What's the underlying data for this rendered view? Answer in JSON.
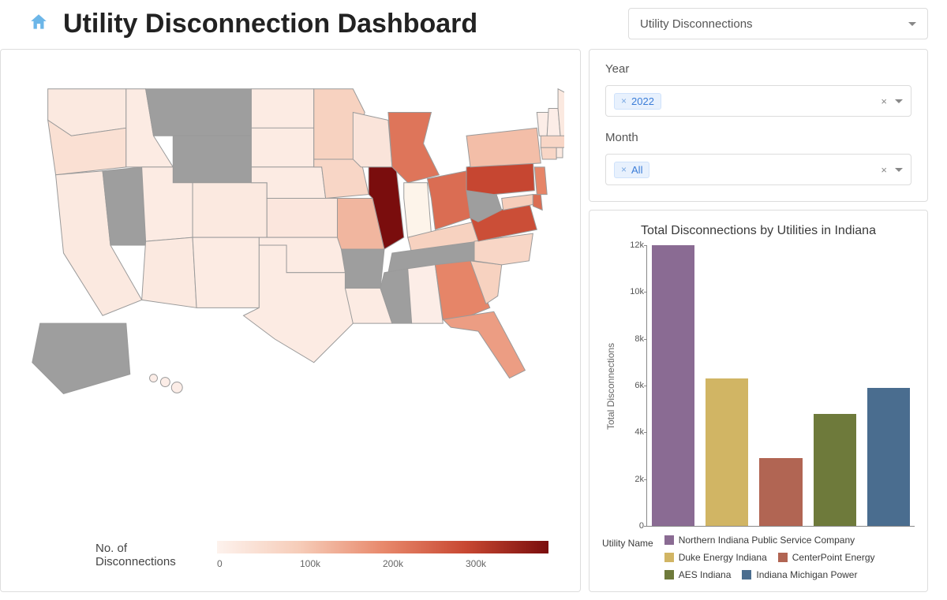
{
  "header": {
    "title": "Utility Disconnection Dashboard",
    "metric_select": "Utility Disconnections"
  },
  "filters": {
    "year": {
      "label": "Year",
      "chip": "2022",
      "clear": "×"
    },
    "month": {
      "label": "Month",
      "chip": "All",
      "clear": "×"
    }
  },
  "map": {
    "legend_title": "No. of Disconnections",
    "legend_ticks": [
      "0",
      "100k",
      "200k",
      "300k"
    ],
    "no_data_color": "#9e9e9e",
    "highlight_state": "Indiana"
  },
  "chart_data": {
    "type": "bar",
    "title": "Total Disconnections by Utilities in Indiana",
    "xlabel": "Utility Name",
    "ylabel": "Total Disconnections",
    "ylim": [
      0,
      12000
    ],
    "yticks": [
      0,
      2000,
      4000,
      6000,
      8000,
      10000,
      12000
    ],
    "ytick_labels": [
      "0",
      "2k",
      "4k",
      "6k",
      "8k",
      "10k",
      "12k"
    ],
    "series": [
      {
        "name": "Northern Indiana Public Service Company",
        "value": 12200,
        "color": "#8a6b93"
      },
      {
        "name": "Duke Energy Indiana",
        "value": 6300,
        "color": "#d1b564"
      },
      {
        "name": "CenterPoint Energy",
        "value": 2900,
        "color": "#b16553"
      },
      {
        "name": "AES Indiana",
        "value": 4800,
        "color": "#6e7a3b"
      },
      {
        "name": "Indiana Michigan Power",
        "value": 5900,
        "color": "#4a6d8f"
      }
    ]
  },
  "state_values": {
    "Illinois": 330000,
    "Pennsylvania": 250000,
    "Virginia": 240000,
    "Ohio": 200000,
    "Michigan": 190000,
    "Georgia": 170000,
    "Florida": 140000,
    "Missouri": 110000,
    "New York": 100000,
    "Kentucky": 70000,
    "Minnesota": 70000,
    "Iowa": 60000,
    "South Carolina": 70000,
    "North Carolina": 60000,
    "New Jersey": 170000,
    "Connecticut": 60000,
    "Massachusetts": 60000,
    "Delaware": 200000,
    "Maryland": 80000,
    "Indiana": 32000,
    "Wisconsin": 30000,
    "California": 20000,
    "Oregon": 40000,
    "Washington": 20000,
    "Colorado": 20000,
    "Kansas": 25000,
    "Texas": 15000,
    "Oklahoma": 15000,
    "New Mexico": 15000,
    "Arizona": 20000,
    "Utah": 15000,
    "Idaho": 15000,
    "North Dakota": 15000,
    "South Dakota": 15000,
    "Nebraska": 15000,
    "Louisiana": 15000,
    "Alabama": 10000,
    "Maine": 20000,
    "New Hampshire": 10000,
    "Vermont": 10000,
    "Rhode Island": 20000,
    "Hawaii": 10000,
    "Montana": null,
    "Wyoming": null,
    "Nevada": null,
    "Alaska": null,
    "Arkansas": null,
    "Mississippi": null,
    "Tennessee": null,
    "West Virginia": null
  }
}
